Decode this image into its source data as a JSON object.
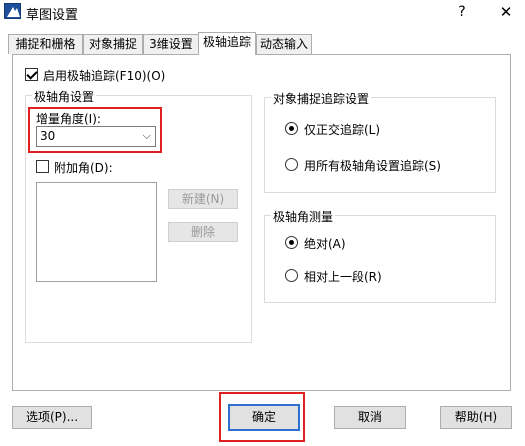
{
  "window": {
    "title": "草图设置",
    "help_label": "?",
    "close_label": "✕"
  },
  "tabs": [
    {
      "label": "捕捉和栅格",
      "active": false
    },
    {
      "label": "对象捕捉",
      "active": false
    },
    {
      "label": "3维设置",
      "active": false
    },
    {
      "label": "极轴追踪",
      "active": true
    },
    {
      "label": "动态输入",
      "active": false
    }
  ],
  "polar": {
    "enable_label": "启用极轴追踪(F10)(O)",
    "enable_checked": true,
    "angle_group_title": "极轴角设置",
    "increment_label": "增量角度(I):",
    "increment_value": "30",
    "additional_label": "附加角(D):",
    "additional_checked": false,
    "new_button": "新建(N)",
    "delete_button": "删除"
  },
  "snap_tracking": {
    "title": "对象捕捉追踪设置",
    "option_orthogonal": "仅正交追踪(L)",
    "option_all": "用所有极轴角设置追踪(S)",
    "selected": "orthogonal"
  },
  "measurement": {
    "title": "极轴角测量",
    "option_absolute": "绝对(A)",
    "option_relative": "相对上一段(R)",
    "selected": "absolute"
  },
  "footer": {
    "options_button": "选项(P)...",
    "ok_button": "确定",
    "cancel_button": "取消",
    "help_button": "帮助(H)"
  },
  "colors": {
    "highlight": "#e02020",
    "default_button_border": "#2f6fd0"
  },
  "icons": {
    "app": "app-logo-icon",
    "combo_arrow": "chevron-down-icon"
  }
}
